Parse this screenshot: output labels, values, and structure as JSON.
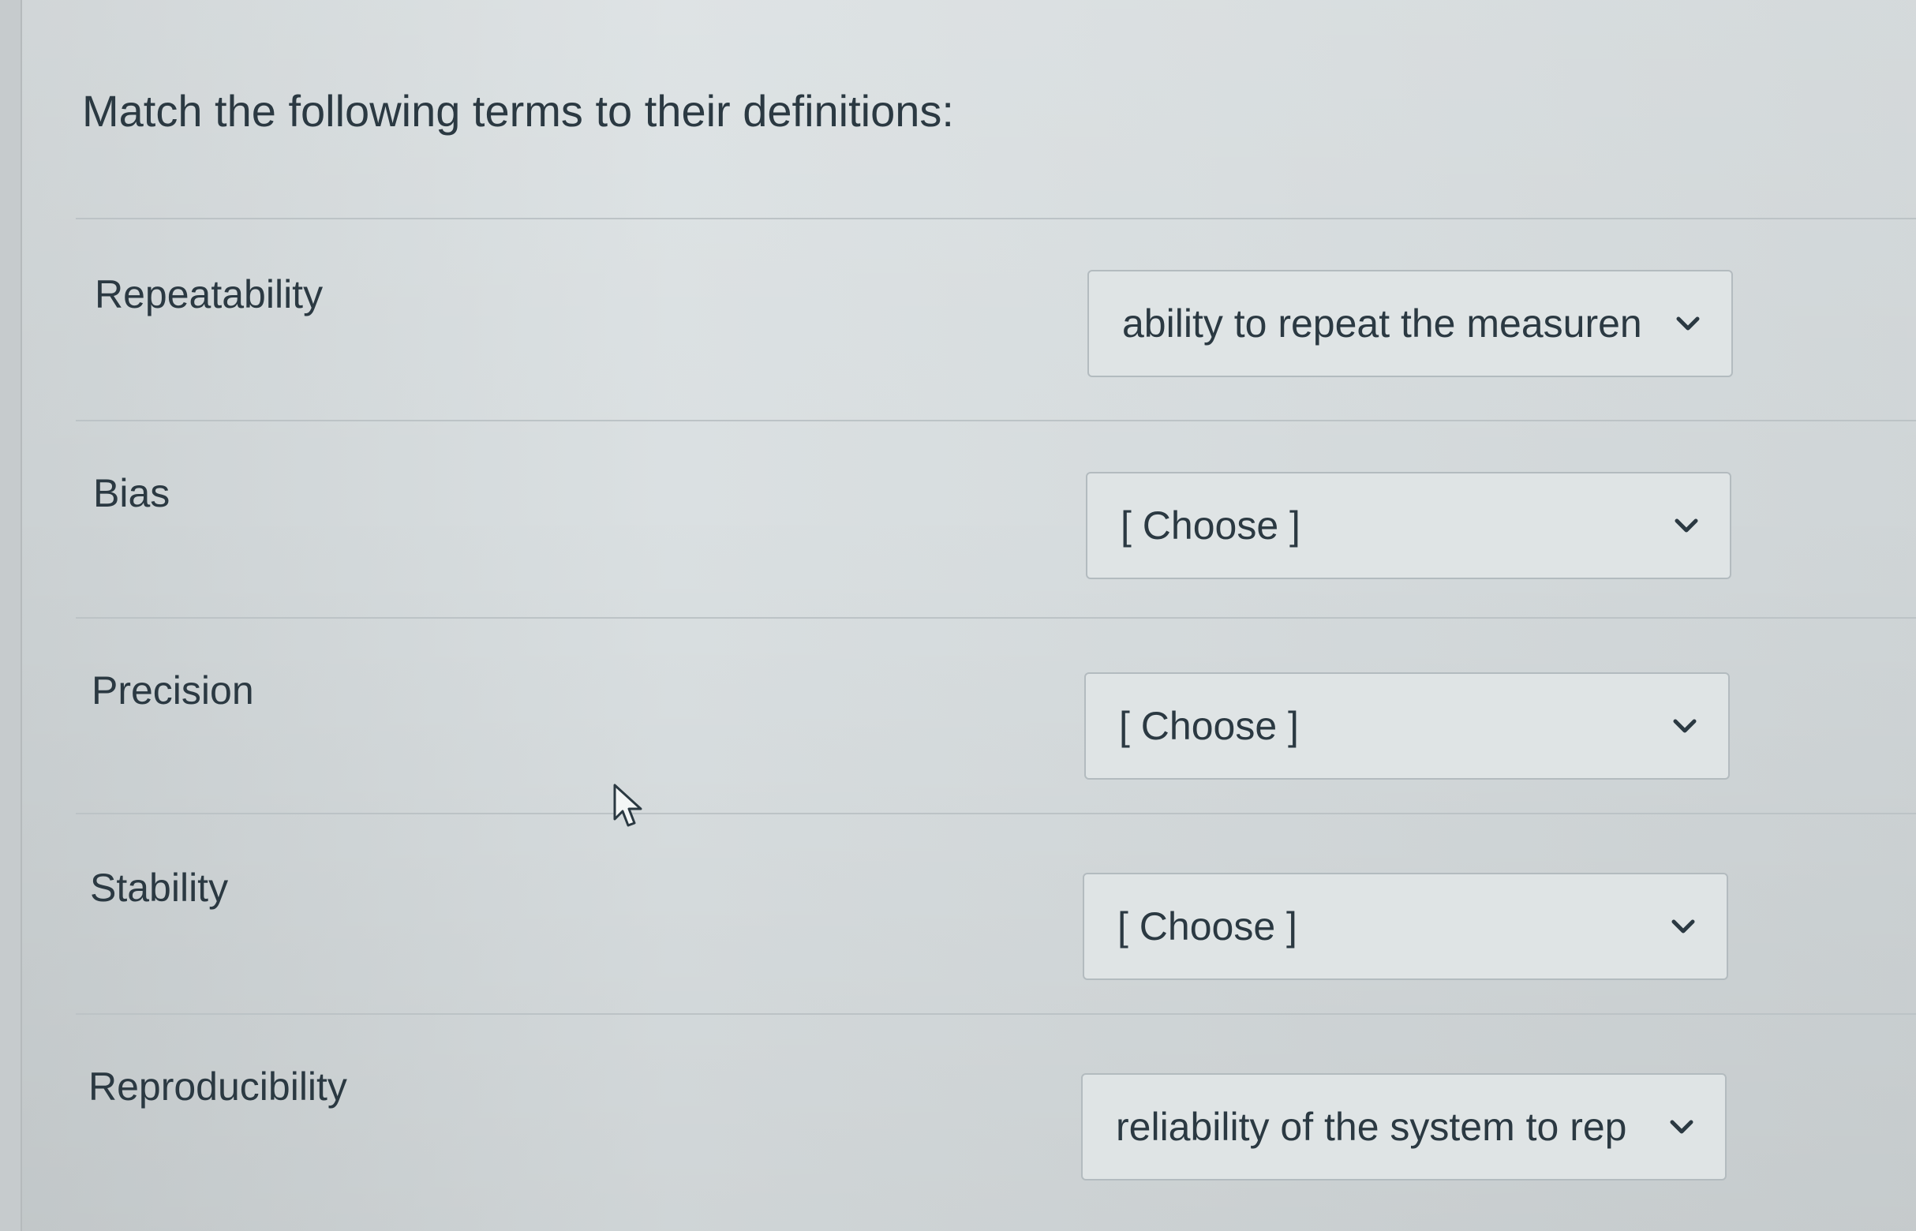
{
  "question": {
    "text": "Match the following terms to their definitions:"
  },
  "rows": [
    {
      "term": "Repeatability",
      "selected": "ability to repeat the measuren"
    },
    {
      "term": "Bias",
      "selected": "[ Choose ]"
    },
    {
      "term": "Precision",
      "selected": "[ Choose ]"
    },
    {
      "term": "Stability",
      "selected": "[ Choose ]"
    },
    {
      "term": "Reproducibility",
      "selected": "reliability of the system to rep"
    }
  ],
  "icons": {
    "dropdown": "chevron-down-icon",
    "pointer": "mouse-cursor-icon"
  }
}
